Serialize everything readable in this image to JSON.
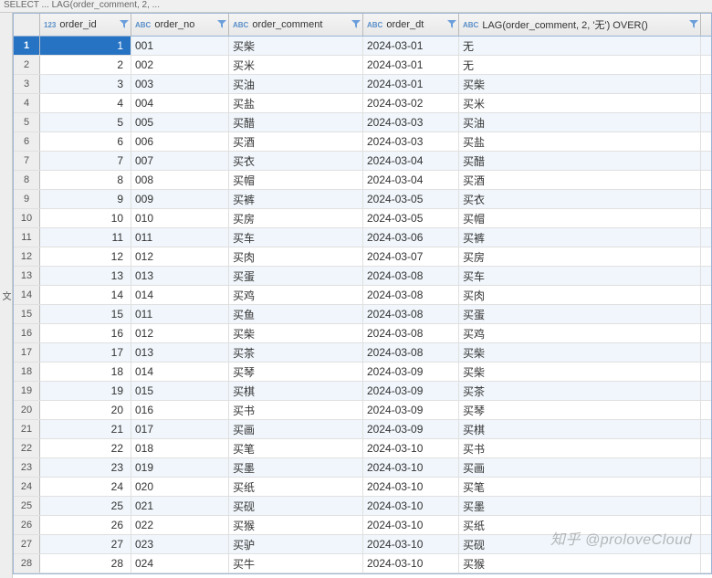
{
  "top_bar": "SELECT ... LAG(order_comment, 2, ...",
  "side_tab": "文",
  "columns": [
    {
      "name": "order_id",
      "type": "123",
      "width": "c1",
      "align": "num"
    },
    {
      "name": "order_no",
      "type": "ABC",
      "width": "c2",
      "align": ""
    },
    {
      "name": "order_comment",
      "type": "ABC",
      "width": "c3",
      "align": ""
    },
    {
      "name": "order_dt",
      "type": "ABC",
      "width": "c4",
      "align": ""
    },
    {
      "name": "LAG(order_comment, 2, '无') OVER()",
      "type": "ABC",
      "width": "c5",
      "align": ""
    }
  ],
  "rows": [
    {
      "n": 1,
      "d": [
        "1",
        "001",
        "买柴",
        "2024-03-01",
        "无"
      ]
    },
    {
      "n": 2,
      "d": [
        "2",
        "002",
        "买米",
        "2024-03-01",
        "无"
      ]
    },
    {
      "n": 3,
      "d": [
        "3",
        "003",
        "买油",
        "2024-03-01",
        "买柴"
      ]
    },
    {
      "n": 4,
      "d": [
        "4",
        "004",
        "买盐",
        "2024-03-02",
        "买米"
      ]
    },
    {
      "n": 5,
      "d": [
        "5",
        "005",
        "买醋",
        "2024-03-03",
        "买油"
      ]
    },
    {
      "n": 6,
      "d": [
        "6",
        "006",
        "买酒",
        "2024-03-03",
        "买盐"
      ]
    },
    {
      "n": 7,
      "d": [
        "7",
        "007",
        "买衣",
        "2024-03-04",
        "买醋"
      ]
    },
    {
      "n": 8,
      "d": [
        "8",
        "008",
        "买帽",
        "2024-03-04",
        "买酒"
      ]
    },
    {
      "n": 9,
      "d": [
        "9",
        "009",
        "买裤",
        "2024-03-05",
        "买衣"
      ]
    },
    {
      "n": 10,
      "d": [
        "10",
        "010",
        "买房",
        "2024-03-05",
        "买帽"
      ]
    },
    {
      "n": 11,
      "d": [
        "11",
        "011",
        "买车",
        "2024-03-06",
        "买裤"
      ]
    },
    {
      "n": 12,
      "d": [
        "12",
        "012",
        "买肉",
        "2024-03-07",
        "买房"
      ]
    },
    {
      "n": 13,
      "d": [
        "13",
        "013",
        "买蛋",
        "2024-03-08",
        "买车"
      ]
    },
    {
      "n": 14,
      "d": [
        "14",
        "014",
        "买鸡",
        "2024-03-08",
        "买肉"
      ]
    },
    {
      "n": 15,
      "d": [
        "15",
        "011",
        "买鱼",
        "2024-03-08",
        "买蛋"
      ]
    },
    {
      "n": 16,
      "d": [
        "16",
        "012",
        "买柴",
        "2024-03-08",
        "买鸡"
      ]
    },
    {
      "n": 17,
      "d": [
        "17",
        "013",
        "买茶",
        "2024-03-08",
        "买柴"
      ]
    },
    {
      "n": 18,
      "d": [
        "18",
        "014",
        "买琴",
        "2024-03-09",
        "买柴"
      ]
    },
    {
      "n": 19,
      "d": [
        "19",
        "015",
        "买棋",
        "2024-03-09",
        "买茶"
      ]
    },
    {
      "n": 20,
      "d": [
        "20",
        "016",
        "买书",
        "2024-03-09",
        "买琴"
      ]
    },
    {
      "n": 21,
      "d": [
        "21",
        "017",
        "买画",
        "2024-03-09",
        "买棋"
      ]
    },
    {
      "n": 22,
      "d": [
        "22",
        "018",
        "买笔",
        "2024-03-10",
        "买书"
      ]
    },
    {
      "n": 23,
      "d": [
        "23",
        "019",
        "买墨",
        "2024-03-10",
        "买画"
      ]
    },
    {
      "n": 24,
      "d": [
        "24",
        "020",
        "买纸",
        "2024-03-10",
        "买笔"
      ]
    },
    {
      "n": 25,
      "d": [
        "25",
        "021",
        "买砚",
        "2024-03-10",
        "买墨"
      ]
    },
    {
      "n": 26,
      "d": [
        "26",
        "022",
        "买猴",
        "2024-03-10",
        "买纸"
      ]
    },
    {
      "n": 27,
      "d": [
        "27",
        "023",
        "买驴",
        "2024-03-10",
        "买砚"
      ]
    },
    {
      "n": 28,
      "d": [
        "28",
        "024",
        "买牛",
        "2024-03-10",
        "买猴"
      ]
    }
  ],
  "selected_row": 1,
  "watermark": "知乎 @proloveCloud"
}
